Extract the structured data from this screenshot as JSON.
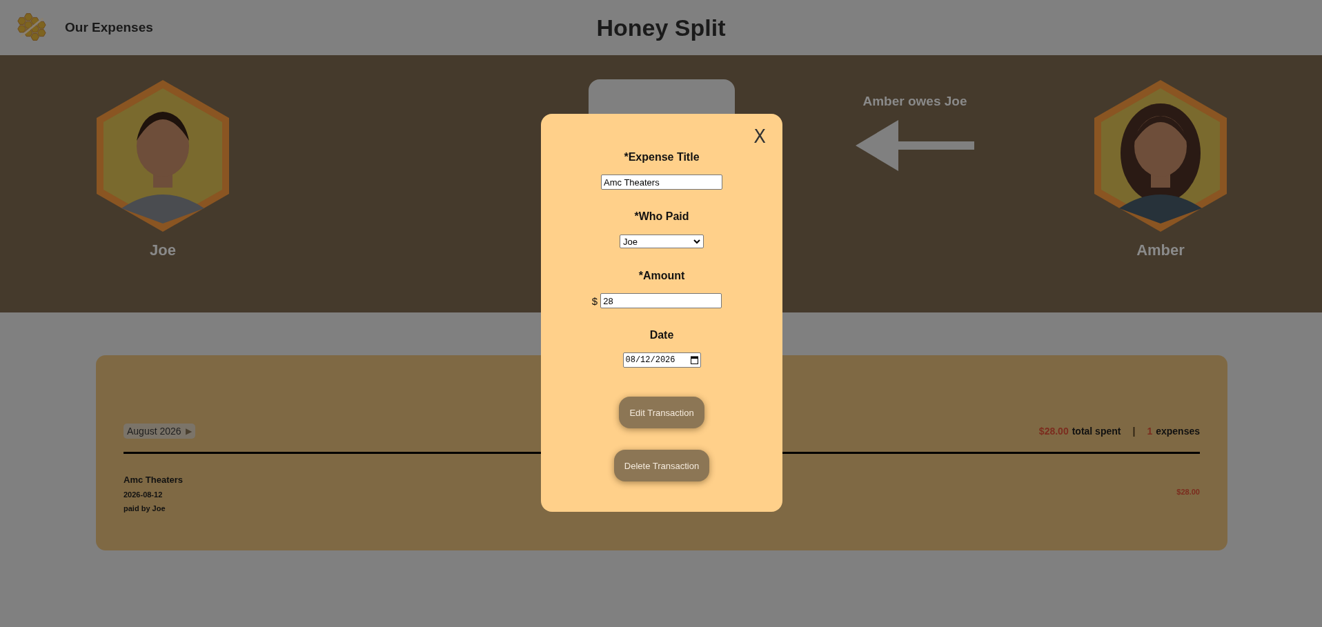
{
  "header": {
    "nav_link": "Our Expenses",
    "title": "Honey Split"
  },
  "people": [
    {
      "name": "Joe"
    },
    {
      "name": "Amber"
    }
  ],
  "balance": {
    "message": "Amber owes Joe"
  },
  "expenses": {
    "month": "August 2026",
    "next": "▶",
    "total": "$28.00",
    "total_label": "total spent",
    "separator": "|",
    "count": "1",
    "count_label": "expenses",
    "items": [
      {
        "title": "Amc Theaters",
        "date": "2026-08-12",
        "paid_by": "paid by Joe",
        "amount": "$28.00"
      }
    ]
  },
  "modal": {
    "close": "X",
    "fields": [
      {
        "kind": "text",
        "label": "*Expense Title",
        "value": "Amc Theaters"
      },
      {
        "kind": "select",
        "label": "*Who Paid",
        "value": "Joe"
      },
      {
        "kind": "currency",
        "label": "*Amount",
        "prefix": "$",
        "value": "28"
      },
      {
        "kind": "date",
        "label": "Date",
        "value": "08/12/2026"
      }
    ],
    "buttons": [
      "Edit Transaction",
      "Delete Transaction"
    ]
  }
}
